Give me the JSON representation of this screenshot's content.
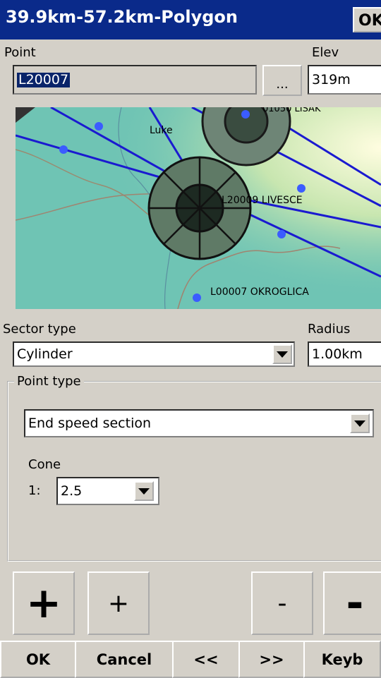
{
  "window": {
    "title": "39.9km-57.2km-Polygon",
    "ok_label": "OK"
  },
  "point": {
    "label": "Point",
    "value": "L20007",
    "browse_label": "..."
  },
  "elev": {
    "label": "Elev",
    "value": "319m"
  },
  "map": {
    "labels": {
      "luke": "Luke",
      "lisak": "01050 LISAK",
      "livesce": "L20009 LIVESCE",
      "okroglica": "L00007 OKROGLICA"
    }
  },
  "sector_type": {
    "label": "Sector type",
    "value": "Cylinder"
  },
  "radius": {
    "label": "Radius",
    "value": "1.00km"
  },
  "point_type": {
    "group_label": "Point type",
    "value": "End speed section"
  },
  "cone": {
    "label": "Cone",
    "prefix": "1:",
    "value": "2.5"
  },
  "adjust": {
    "big_plus": "+",
    "small_plus": "+",
    "small_minus": "-",
    "big_minus": "-"
  },
  "bottom": {
    "ok": "OK",
    "cancel": "Cancel",
    "prev": "<<",
    "next": ">>",
    "keyb": "Keyb"
  },
  "colors": {
    "title_bar": "#0a2a8a",
    "route_line": "#1a1ad0",
    "waypoint": "#3b5cff",
    "map_base": "#6fc4b4"
  }
}
